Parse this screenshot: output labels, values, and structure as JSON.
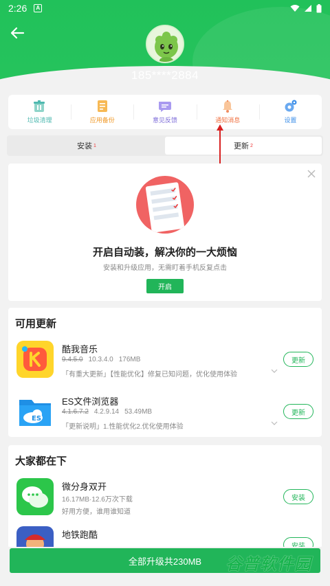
{
  "status": {
    "time": "2:26",
    "notif_icon": "A"
  },
  "user": {
    "phone": "185****2884"
  },
  "tools": [
    {
      "label": "垃圾清理",
      "icon": "trash-clean-icon",
      "color": "#4fb9b0"
    },
    {
      "label": "应用备份",
      "icon": "app-backup-icon",
      "color": "#f4a030"
    },
    {
      "label": "意见反馈",
      "icon": "feedback-icon",
      "color": "#8f7ee6"
    },
    {
      "label": "通知消息",
      "icon": "bell-icon",
      "color": "#f08c60"
    },
    {
      "label": "设置",
      "icon": "gear-icon",
      "color": "#3d8fe8"
    }
  ],
  "tabs": [
    {
      "label": "安装",
      "count": "1"
    },
    {
      "label": "更新",
      "count": "2"
    }
  ],
  "promo": {
    "title": "开启自动装，解决你的一大烦恼",
    "subtitle": "安装和升级应用，无需盯着手机反复点击",
    "button": "开启"
  },
  "updates": {
    "title": "可用更新",
    "items": [
      {
        "name": "酷我音乐",
        "old_version": "9.4.5.0",
        "new_version": "10.3.4.0",
        "size": "176MB",
        "desc": "「有重大更新」【性能优化】修复已知问题，优化使用体验",
        "button": "更新"
      },
      {
        "name": "ES文件浏览器",
        "old_version": "4.1.6.7.2",
        "new_version": "4.2.9.14",
        "size": "53.49MB",
        "desc": "「更新说明」1.性能优化2.优化使用体验",
        "button": "更新"
      }
    ]
  },
  "popular": {
    "title": "大家都在下",
    "items": [
      {
        "name": "微分身双开",
        "meta": "16.17MB·12.6万次下载",
        "desc": "好用方便，谁用谁知道",
        "button": "安装"
      },
      {
        "name": "地铁跑酷",
        "meta": "",
        "desc": "",
        "button": "安装"
      }
    ]
  },
  "bottom": {
    "button": "全部升级共230MB"
  },
  "watermark": "谷普软件园"
}
